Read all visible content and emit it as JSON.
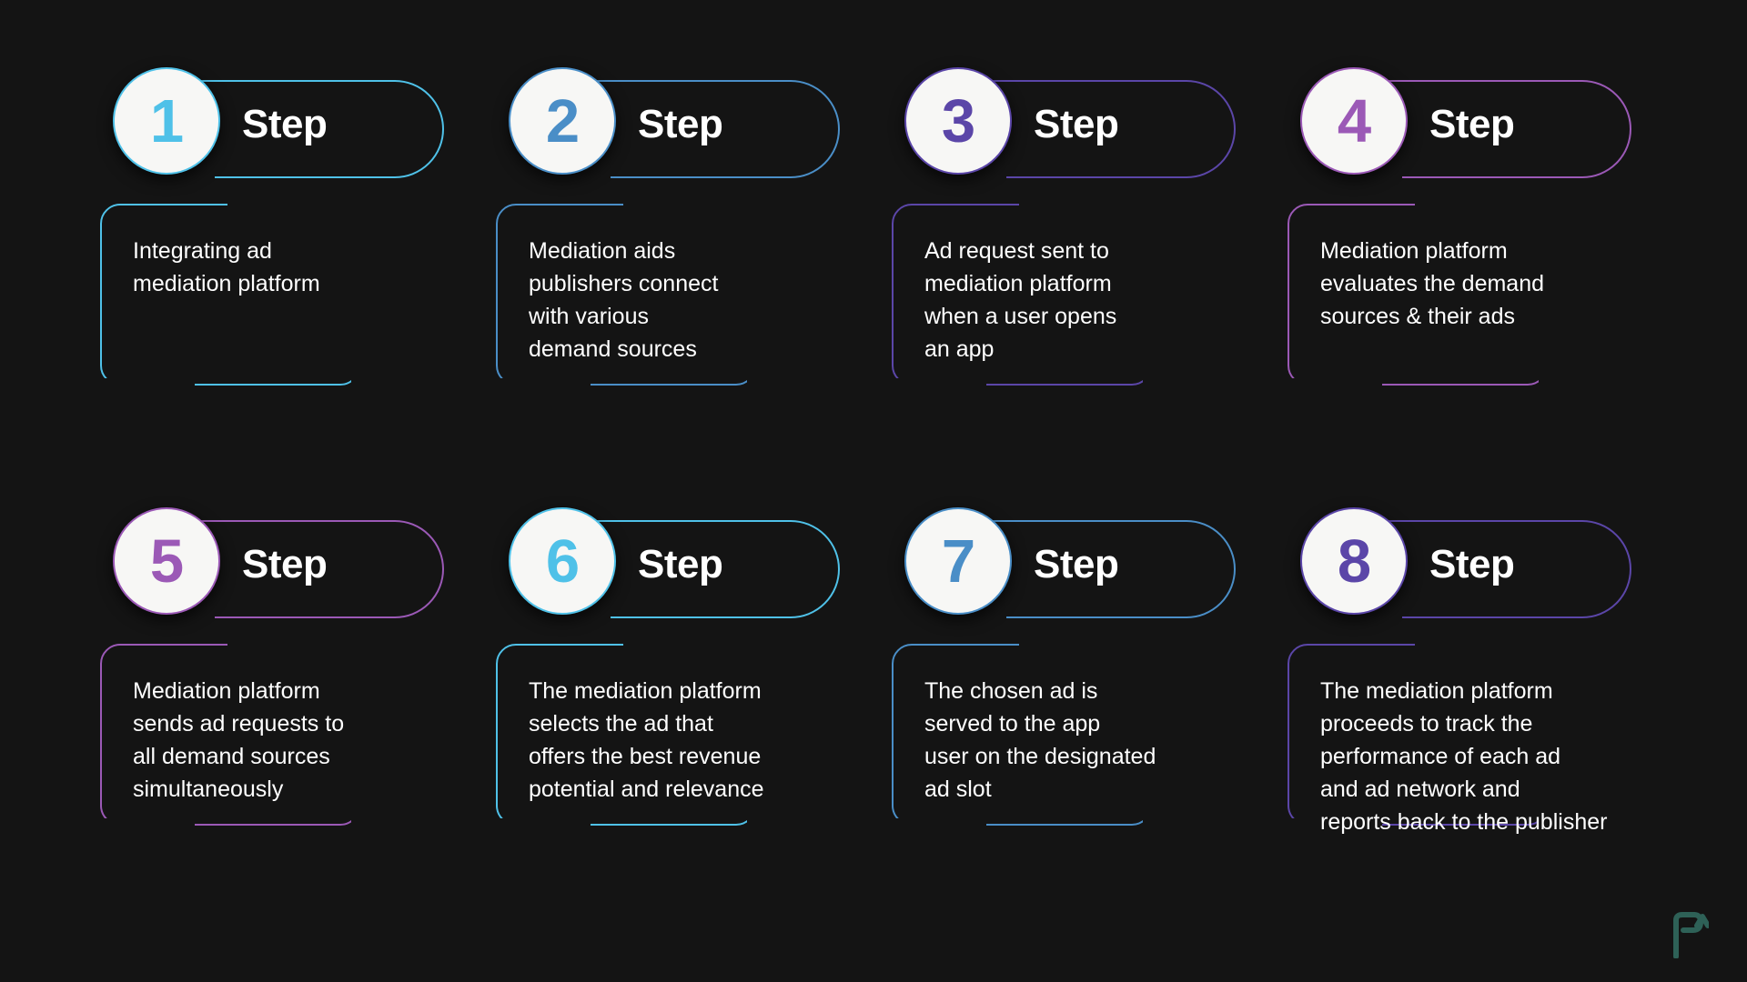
{
  "background": "#141414",
  "palette": {
    "cyan": "#4FC1E8",
    "steel_blue": "#4A8EC7",
    "indigo": "#5B46A8",
    "amethyst": "#9B59B6",
    "text": "#FFFFFF",
    "circle_fill": "#F7F7F5",
    "logo": "#2E6157"
  },
  "logo": {
    "name": "p-arrow-logo",
    "letter": "P"
  },
  "steps": [
    {
      "number": "1",
      "label": "Step",
      "color": "#4FC1E8",
      "body": "Integrating ad\nmediation platform"
    },
    {
      "number": "2",
      "label": "Step",
      "color": "#4A8EC7",
      "body": "Mediation aids\npublishers connect\nwith various\ndemand sources"
    },
    {
      "number": "3",
      "label": "Step",
      "color": "#5B46A8",
      "body": "Ad request sent to\nmediation platform\nwhen a user opens\nan app"
    },
    {
      "number": "4",
      "label": "Step",
      "color": "#9B59B6",
      "body": "Mediation platform\nevaluates the demand\nsources & their ads"
    },
    {
      "number": "5",
      "label": "Step",
      "color": "#9B59B6",
      "body": "Mediation platform\nsends ad requests to\nall demand sources\nsimultaneously"
    },
    {
      "number": "6",
      "label": "Step",
      "color": "#4FC1E8",
      "body": "The mediation platform\nselects the ad that\noffers the best revenue\npotential and relevance"
    },
    {
      "number": "7",
      "label": "Step",
      "color": "#4A8EC7",
      "body": "The chosen ad is\nserved to the app\nuser on the designated\nad slot"
    },
    {
      "number": "8",
      "label": "Step",
      "color": "#5B46A8",
      "body": "The mediation platform\nproceeds to track the\nperformance of each ad\nand ad network and\nreports back to the publisher"
    }
  ]
}
